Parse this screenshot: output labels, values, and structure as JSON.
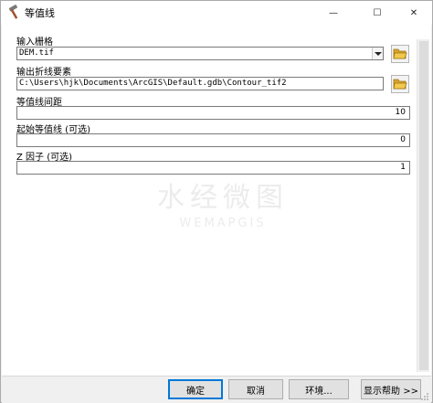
{
  "window": {
    "title": "等值线",
    "controls": {
      "minimize": "—",
      "maximize": "☐",
      "close": "✕"
    }
  },
  "form": {
    "input_raster": {
      "label": "输入栅格",
      "value": "DEM.tif"
    },
    "output_features": {
      "label": "输出折线要素",
      "value": "C:\\Users\\hjk\\Documents\\ArcGIS\\Default.gdb\\Contour_tif2"
    },
    "contour_interval": {
      "label": "等值线间距",
      "value": "10"
    },
    "base_contour": {
      "label": "起始等值线 (可选)",
      "value": "0"
    },
    "z_factor": {
      "label": "Z 因子 (可选)",
      "value": "1"
    }
  },
  "watermark": {
    "line1": "水经微图",
    "line2": "WEMAPGIS"
  },
  "buttons": {
    "ok": "确定",
    "cancel": "取消",
    "environments": "环境...",
    "show_help": "显示帮助 >>"
  },
  "colors": {
    "accent": "#0078d7",
    "folder": "#e8b33a"
  },
  "icons": {
    "title": "hammer-icon",
    "browse": "folder-open-icon",
    "dropdown": "chevron-down-icon"
  }
}
